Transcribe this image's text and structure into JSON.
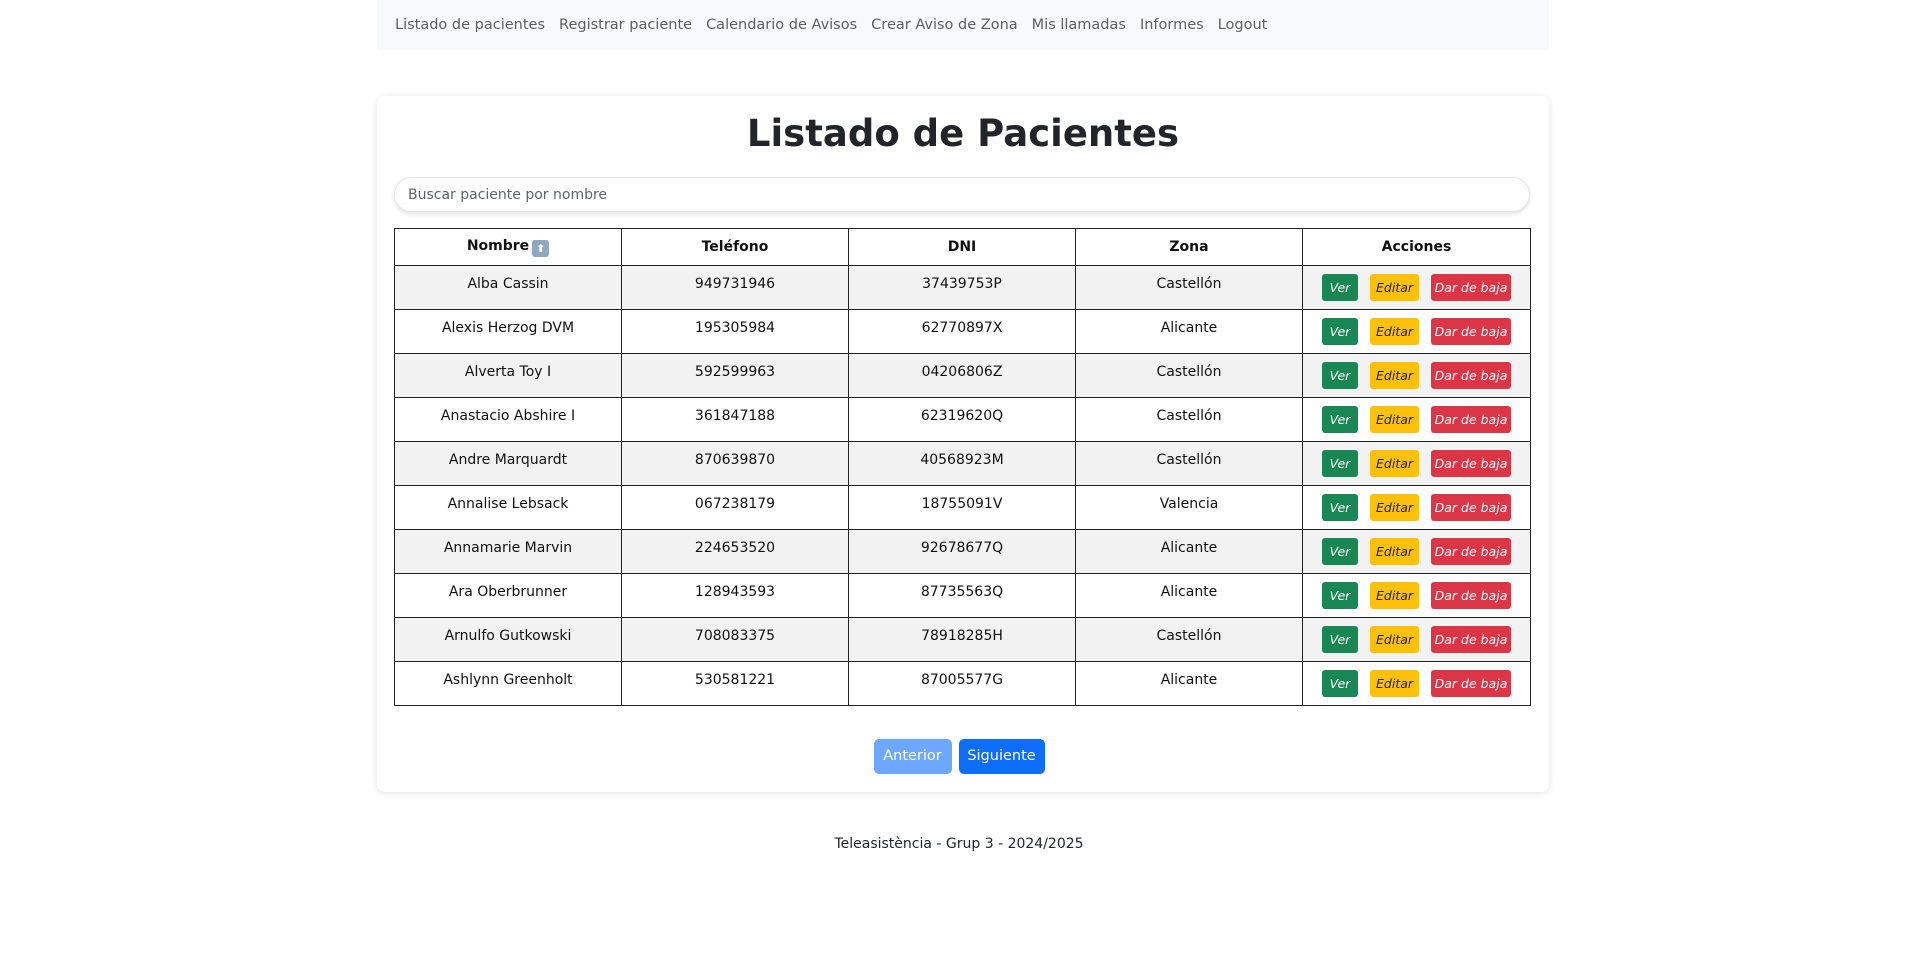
{
  "nav": {
    "items": [
      {
        "label": "Listado de pacientes"
      },
      {
        "label": "Registrar paciente"
      },
      {
        "label": "Calendario de Avisos"
      },
      {
        "label": "Crear Aviso de Zona"
      },
      {
        "label": "Mis llamadas"
      },
      {
        "label": "Informes"
      },
      {
        "label": "Logout"
      }
    ]
  },
  "page": {
    "title": "Listado de Pacientes",
    "search_placeholder": "Buscar paciente por nombre",
    "search_value": ""
  },
  "table": {
    "headers": {
      "nombre": "Nombre",
      "sort_icon": "⬆",
      "telefono": "Teléfono",
      "dni": "DNI",
      "zona": "Zona",
      "acciones": "Acciones"
    },
    "action_labels": {
      "ver": "Ver",
      "editar": "Editar",
      "baja": "Dar de baja"
    },
    "rows": [
      {
        "nombre": "Alba Cassin",
        "telefono": "949731946",
        "dni": "37439753P",
        "zona": "Castellón"
      },
      {
        "nombre": "Alexis Herzog DVM",
        "telefono": "195305984",
        "dni": "62770897X",
        "zona": "Alicante"
      },
      {
        "nombre": "Alverta Toy I",
        "telefono": "592599963",
        "dni": "04206806Z",
        "zona": "Castellón"
      },
      {
        "nombre": "Anastacio Abshire I",
        "telefono": "361847188",
        "dni": "62319620Q",
        "zona": "Castellón"
      },
      {
        "nombre": "Andre Marquardt",
        "telefono": "870639870",
        "dni": "40568923M",
        "zona": "Castellón"
      },
      {
        "nombre": "Annalise Lebsack",
        "telefono": "067238179",
        "dni": "18755091V",
        "zona": "Valencia"
      },
      {
        "nombre": "Annamarie Marvin",
        "telefono": "224653520",
        "dni": "92678677Q",
        "zona": "Alicante"
      },
      {
        "nombre": "Ara Oberbrunner",
        "telefono": "128943593",
        "dni": "87735563Q",
        "zona": "Alicante"
      },
      {
        "nombre": "Arnulfo Gutkowski",
        "telefono": "708083375",
        "dni": "78918285H",
        "zona": "Castellón"
      },
      {
        "nombre": "Ashlynn Greenholt",
        "telefono": "530581221",
        "dni": "87005577G",
        "zona": "Alicante"
      }
    ]
  },
  "pagination": {
    "prev_label": "Anterior",
    "next_label": "Siguiente"
  },
  "footer": {
    "text": "Teleasistència - Grup 3 - 2024/2025"
  },
  "colors": {
    "nav_bg": "#f8f9fa",
    "ver": "#198754",
    "editar": "#ffc107",
    "baja": "#dc3545",
    "prev": "#6ea8fe",
    "next": "#0d6efd"
  }
}
